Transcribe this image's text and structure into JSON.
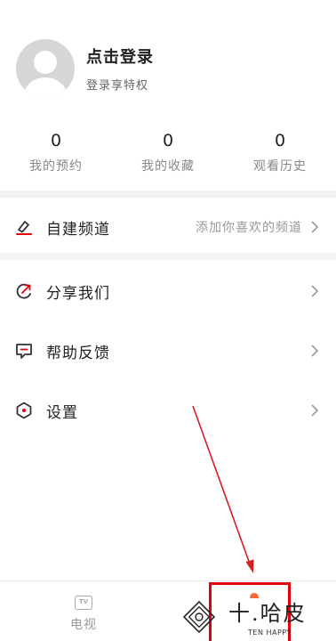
{
  "profile": {
    "login_title": "点击登录",
    "login_subtitle": "登录享特权"
  },
  "stats": [
    {
      "value": "0",
      "label": "我的预约"
    },
    {
      "value": "0",
      "label": "我的收藏"
    },
    {
      "value": "0",
      "label": "观看历史"
    }
  ],
  "menu": {
    "custom_channel": {
      "label": "自建频道",
      "hint": "添加你喜欢的频道",
      "icon": "pencil-icon"
    },
    "share": {
      "label": "分享我们",
      "icon": "share-icon"
    },
    "feedback": {
      "label": "帮助反馈",
      "icon": "feedback-icon"
    },
    "settings": {
      "label": "设置",
      "icon": "settings-icon"
    }
  },
  "tabbar": {
    "tv": {
      "icon_text": "TV",
      "label": "电视"
    }
  },
  "watermark": {
    "title": "十.哈皮",
    "subtitle": "TEN HAPPY"
  },
  "colors": {
    "accent_red": "#e3000b",
    "annotation_arrow": "#d42020",
    "divider": "#f2f2f2",
    "text_muted": "#888888"
  }
}
